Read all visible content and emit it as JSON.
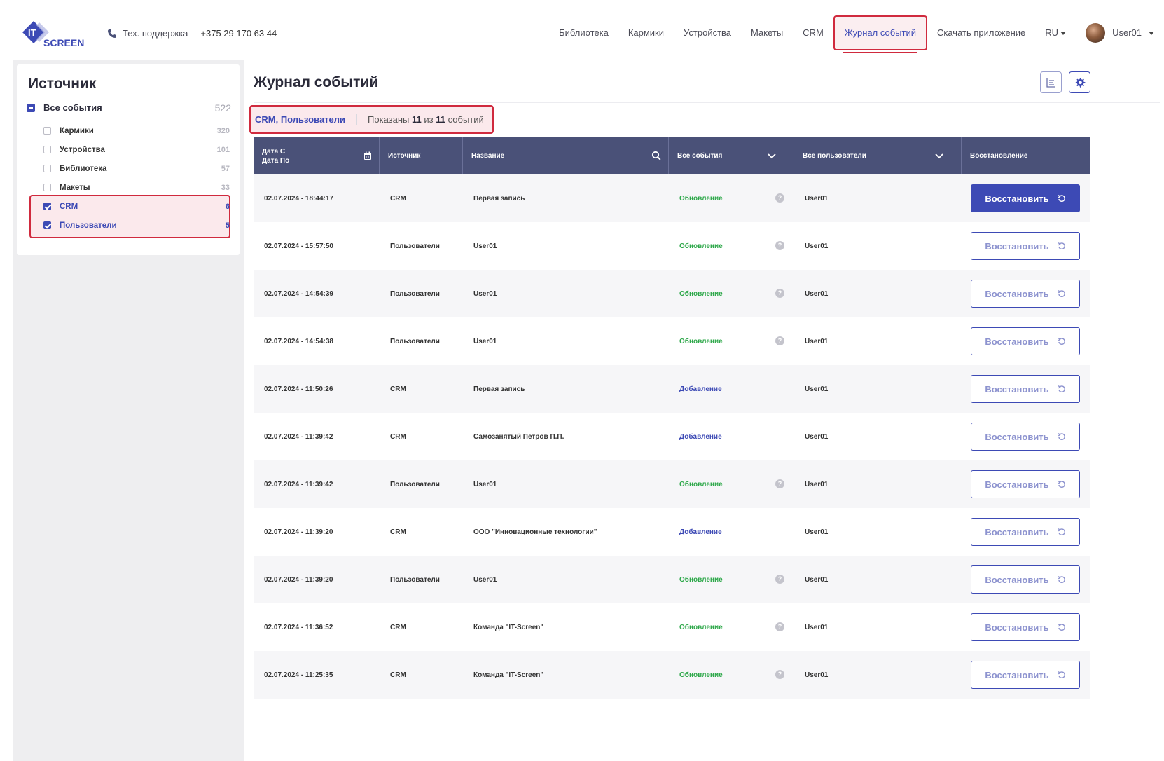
{
  "header": {
    "logo_text_top": "IT",
    "logo_text_bottom": "SCREEN",
    "support_label": "Тех. поддержка",
    "support_phone": "+375 29 170 63 44",
    "nav": [
      {
        "label": "Библиотека"
      },
      {
        "label": "Кармики"
      },
      {
        "label": "Устройства"
      },
      {
        "label": "Макеты"
      },
      {
        "label": "CRM"
      },
      {
        "label": "Журнал событий",
        "active": true
      },
      {
        "label": "Скачать приложение"
      }
    ],
    "lang": "RU",
    "user": "User01"
  },
  "sidebar": {
    "title": "Источник",
    "all": {
      "label": "Все события",
      "count": "522"
    },
    "items": [
      {
        "label": "Кармики",
        "count": "320",
        "checked": false
      },
      {
        "label": "Устройства",
        "count": "101",
        "checked": false
      },
      {
        "label": "Библиотека",
        "count": "57",
        "checked": false
      },
      {
        "label": "Макеты",
        "count": "33",
        "checked": false
      },
      {
        "label": "CRM",
        "count": "6",
        "checked": true
      },
      {
        "label": "Пользователи",
        "count": "5",
        "checked": true
      }
    ]
  },
  "main": {
    "title": "Журнал событий",
    "filter": {
      "sources": "CRM, Пользователи",
      "shown_prefix": "Показаны",
      "shown_count": "11",
      "shown_middle": "из",
      "shown_total": "11",
      "shown_suffix": "событий"
    },
    "columns": {
      "date_from": "Дата С",
      "date_to": "Дата По",
      "source": "Источник",
      "name": "Название",
      "events": "Все события",
      "users": "Все пользователи",
      "restore": "Восстановление"
    },
    "restore_label": "Восстановить",
    "help_mark": "?",
    "rows": [
      {
        "date": "02.07.2024 - 18:44:17",
        "source": "CRM",
        "name": "Первая запись",
        "event": "Обновление",
        "type": "upd",
        "user": "User01"
      },
      {
        "date": "02.07.2024 - 15:57:50",
        "source": "Пользователи",
        "name": "User01",
        "event": "Обновление",
        "type": "upd",
        "user": "User01"
      },
      {
        "date": "02.07.2024 - 14:54:39",
        "source": "Пользователи",
        "name": "User01",
        "event": "Обновление",
        "type": "upd",
        "user": "User01"
      },
      {
        "date": "02.07.2024 - 14:54:38",
        "source": "Пользователи",
        "name": "User01",
        "event": "Обновление",
        "type": "upd",
        "user": "User01"
      },
      {
        "date": "02.07.2024 - 11:50:26",
        "source": "CRM",
        "name": "Первая запись",
        "event": "Добавление",
        "type": "add",
        "user": "User01"
      },
      {
        "date": "02.07.2024 - 11:39:42",
        "source": "CRM",
        "name": "Самозанятый Петров П.П.",
        "event": "Добавление",
        "type": "add",
        "user": "User01"
      },
      {
        "date": "02.07.2024 - 11:39:42",
        "source": "Пользователи",
        "name": "User01",
        "event": "Обновление",
        "type": "upd",
        "user": "User01"
      },
      {
        "date": "02.07.2024 - 11:39:20",
        "source": "CRM",
        "name": "ООО \"Инновационные технологии\"",
        "event": "Добавление",
        "type": "add",
        "user": "User01"
      },
      {
        "date": "02.07.2024 - 11:39:20",
        "source": "Пользователи",
        "name": "User01",
        "event": "Обновление",
        "type": "upd",
        "user": "User01"
      },
      {
        "date": "02.07.2024 - 11:36:52",
        "source": "CRM",
        "name": "Команда \"IT-Screen\"",
        "event": "Обновление",
        "type": "upd",
        "user": "User01"
      },
      {
        "date": "02.07.2024 - 11:25:35",
        "source": "CRM",
        "name": "Команда \"IT-Screen\"",
        "event": "Обновление",
        "type": "upd",
        "user": "User01"
      }
    ]
  },
  "colors": {
    "accent": "#3d4ab5",
    "header_row": "#4a5178",
    "highlight": "#d02a3e",
    "update": "#2ea84a"
  },
  "icons": [
    "phone-icon",
    "calendar-icon",
    "search-icon",
    "chevron-down-icon",
    "help-icon",
    "restore-icon",
    "list-icon",
    "gear-icon"
  ]
}
